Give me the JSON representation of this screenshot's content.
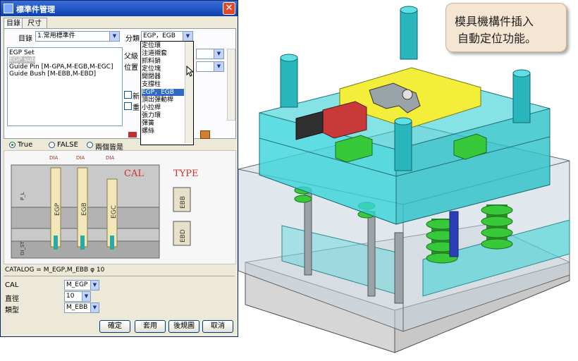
{
  "window": {
    "title": "標準件管理",
    "close": "✕"
  },
  "tabs": [
    {
      "label": "目錄"
    },
    {
      "label": "尺寸"
    }
  ],
  "catalog": {
    "label": "目錄",
    "value": "1.常用標準件"
  },
  "category": {
    "label": "分類",
    "value": "EGP，EGB"
  },
  "parent": {
    "label": "父級"
  },
  "position": {
    "label": "位置"
  },
  "checkbox_new": {
    "label": "新"
  },
  "checkbox_re": {
    "label": "重"
  },
  "list_items": [
    {
      "label": "EGP Set"
    },
    {
      "label": "EGP sub"
    },
    {
      "label": "Guide Pin [M-GPA,M-EGB,M-EGC]"
    },
    {
      "label": "Guide Bush [M-EBB,M-EBD]"
    }
  ],
  "dropdown_options": [
    {
      "label": "定位環"
    },
    {
      "label": "注道襯套"
    },
    {
      "label": "抓料銷"
    },
    {
      "label": "定位塊"
    },
    {
      "label": "開閉器"
    },
    {
      "label": "支撐柱"
    },
    {
      "label": "EGP，EGB"
    },
    {
      "label": "頂出彈動桿"
    },
    {
      "label": "小拉桿"
    },
    {
      "label": "張力環"
    },
    {
      "label": "彈簧"
    },
    {
      "label": "螺絲"
    }
  ],
  "radios": [
    {
      "label": "True",
      "selected": true
    },
    {
      "label": "FALSE",
      "selected": false
    },
    {
      "label": "兩個皆是",
      "selected": false
    }
  ],
  "diagram": {
    "cal": "CAL",
    "type": "TYPE",
    "pins": [
      "EGP",
      "EGB",
      "EGC"
    ],
    "dia": "DIA",
    "pl": "P_L",
    "dist": "DI_ST",
    "types": [
      "EBB",
      "EBD"
    ]
  },
  "catalog_line": "CATALOG = M_EGP,M_EBB  φ 10",
  "fields": [
    {
      "label": "CAL",
      "value": "M_EGP"
    },
    {
      "label": "直徑",
      "value": "10"
    },
    {
      "label": "類型",
      "value": "M_EBB"
    }
  ],
  "buttons": [
    {
      "label": "確定"
    },
    {
      "label": "套用"
    },
    {
      "label": "後規圖"
    },
    {
      "label": "取消"
    }
  ],
  "callout": {
    "line1": "模具機構件插入",
    "line2": "自動定位功能。"
  },
  "colors": {
    "cyan_plate": "#33d1d6",
    "yellow_plate": "#f2ee3a",
    "green_spring": "#38c93a",
    "titlebar": "#0a3fb0"
  }
}
